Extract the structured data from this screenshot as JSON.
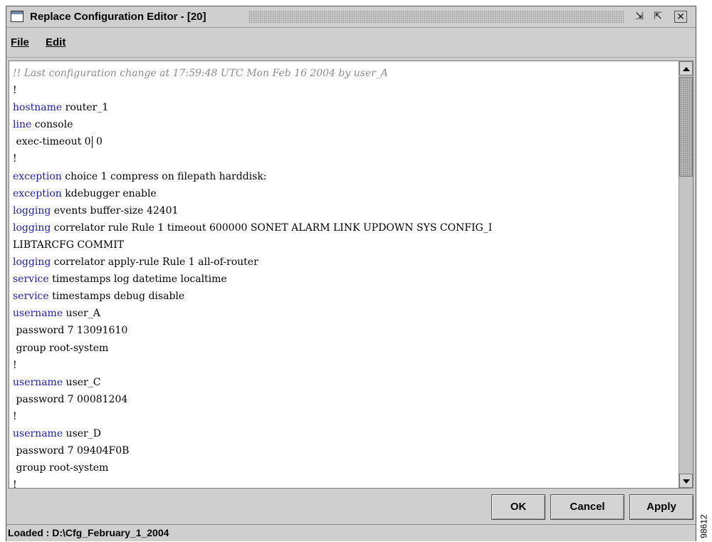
{
  "window": {
    "title": "Replace Configuration Editor - [20]",
    "controls": {
      "restore_glyph": "⇲",
      "maximize_glyph": "⇱",
      "close_glyph": "✕"
    }
  },
  "menubar": {
    "file_label": "File",
    "edit_label": "Edit"
  },
  "editor": {
    "lines": [
      {
        "kw": "",
        "text": "",
        "comment": "!! Last configuration change at 17:59:48 UTC Mon Feb 16 2004 by user_A"
      },
      {
        "kw": "",
        "text": "!"
      },
      {
        "kw": "hostname",
        "text": " router_1"
      },
      {
        "kw": "line",
        "text": " console"
      },
      {
        "kw": "",
        "text": " exec-timeout 0",
        "caret": true,
        "after": " 0"
      },
      {
        "kw": "",
        "text": "!"
      },
      {
        "kw": "exception",
        "text": " choice 1 compress on filepath harddisk:"
      },
      {
        "kw": "exception",
        "text": " kdebugger enable"
      },
      {
        "kw": "logging",
        "text": " events buffer-size 42401"
      },
      {
        "kw": "logging",
        "text": " correlator rule Rule 1 timeout 600000 SONET ALARM LINK UPDOWN SYS CONFIG_I"
      },
      {
        "kw": "",
        "text": "LIBTARCFG COMMIT"
      },
      {
        "kw": "logging",
        "text": " correlator apply-rule Rule 1 all-of-router"
      },
      {
        "kw": "service",
        "text": " timestamps log datetime localtime"
      },
      {
        "kw": "service",
        "text": " timestamps debug disable"
      },
      {
        "kw": "username",
        "text": " user_A"
      },
      {
        "kw": "",
        "text": " password 7 13091610"
      },
      {
        "kw": "",
        "text": " group root-system"
      },
      {
        "kw": "",
        "text": "!"
      },
      {
        "kw": "username",
        "text": " user_C"
      },
      {
        "kw": "",
        "text": " password 7 00081204"
      },
      {
        "kw": "",
        "text": "!"
      },
      {
        "kw": "username",
        "text": " user_D"
      },
      {
        "kw": "",
        "text": " password 7 09404F0B"
      },
      {
        "kw": "",
        "text": " group root-system"
      },
      {
        "kw": "",
        "text": "!"
      }
    ]
  },
  "buttons": {
    "ok_label": "OK",
    "cancel_label": "Cancel",
    "apply_label": "Apply"
  },
  "status": {
    "text": "Loaded : D:\\Cfg_February_1_2004"
  },
  "figure_id": "98612",
  "colors": {
    "keyword": "#1a1ac8",
    "comment": "#8c8c8c",
    "chrome": "#cfcfcf"
  }
}
